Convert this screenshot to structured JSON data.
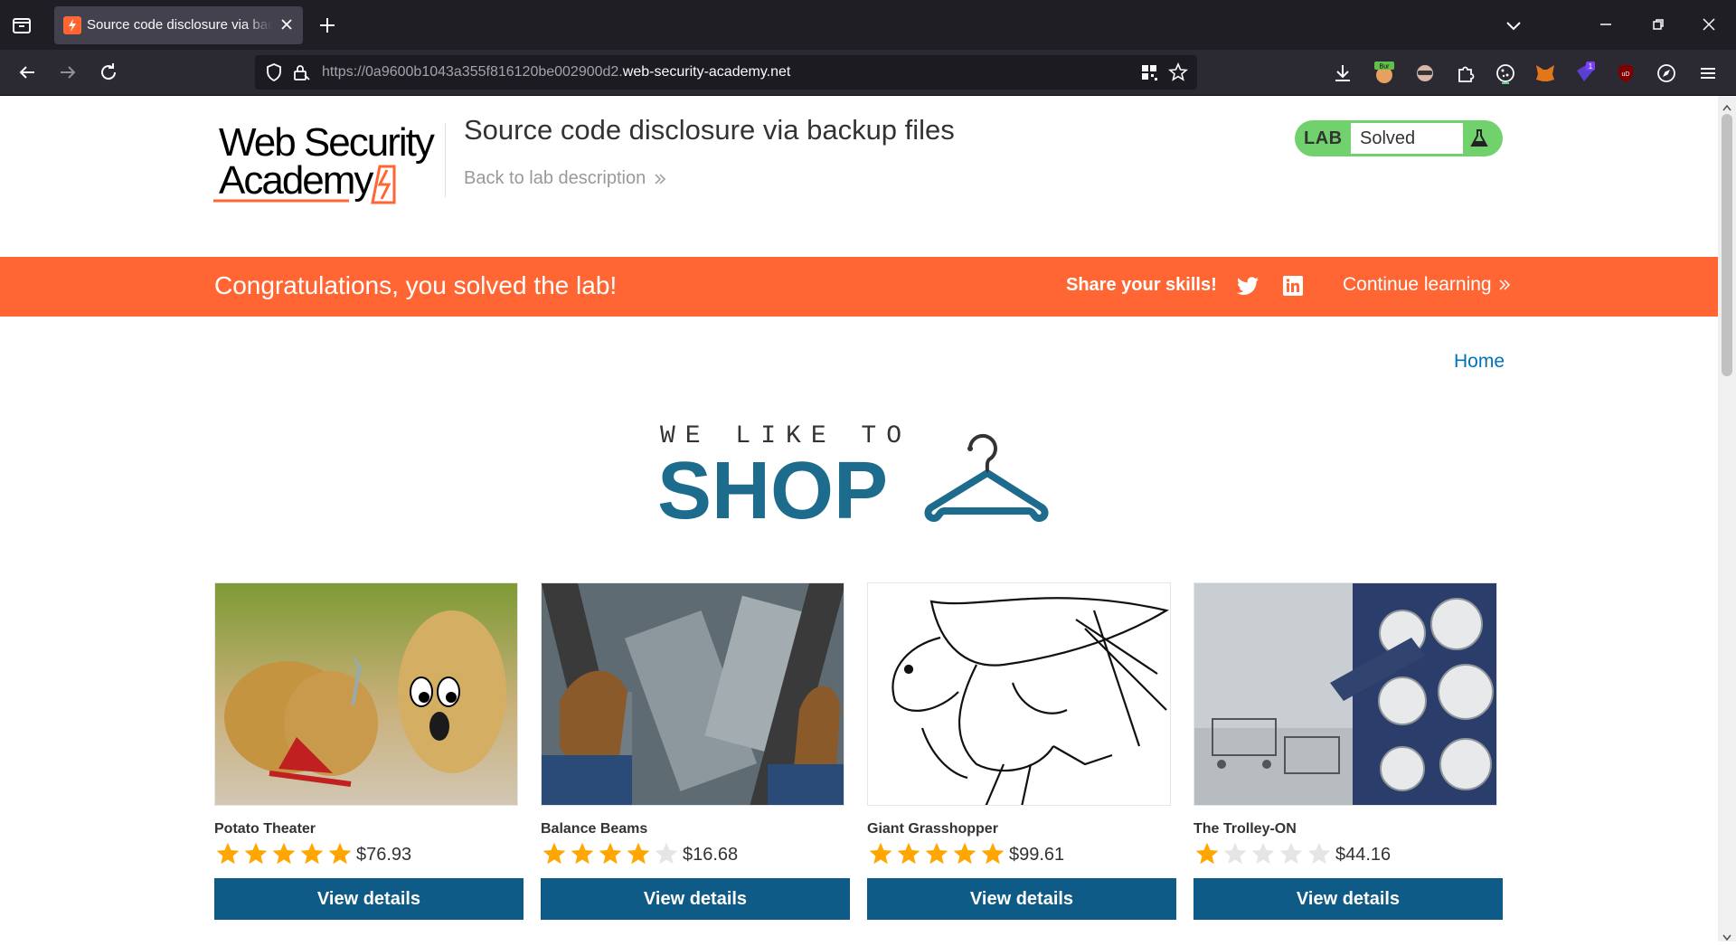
{
  "browser": {
    "tab_title": "Source code disclosure via backup files",
    "url_prefix": "https://0a9600b1043a355f816120be002900d2.",
    "url_domain": "web-security-academy.net"
  },
  "header": {
    "logo_line1": "Web Security",
    "logo_line2": "Academy",
    "lab_title": "Source code disclosure via backup files",
    "back_link": "Back to lab description",
    "lab_badge": "LAB",
    "lab_status": "Solved",
    "status_color": "#70d16d"
  },
  "notification": {
    "message": "Congratulations, you solved the lab!",
    "share_label": "Share your skills!",
    "continue_label": "Continue learning",
    "color": "#ff6633"
  },
  "nav": {
    "home": "Home"
  },
  "shop_logo": {
    "line1": "WE LIKE TO",
    "line2": "SHOP"
  },
  "products": [
    {
      "name": "Potato Theater",
      "rating": 5,
      "price": "$76.93",
      "button": "View details"
    },
    {
      "name": "Balance Beams",
      "rating": 4,
      "price": "$16.68",
      "button": "View details"
    },
    {
      "name": "Giant Grasshopper",
      "rating": 5,
      "price": "$99.61",
      "button": "View details"
    },
    {
      "name": "The Trolley-ON",
      "rating": 1,
      "price": "$44.16",
      "button": "View details"
    }
  ]
}
